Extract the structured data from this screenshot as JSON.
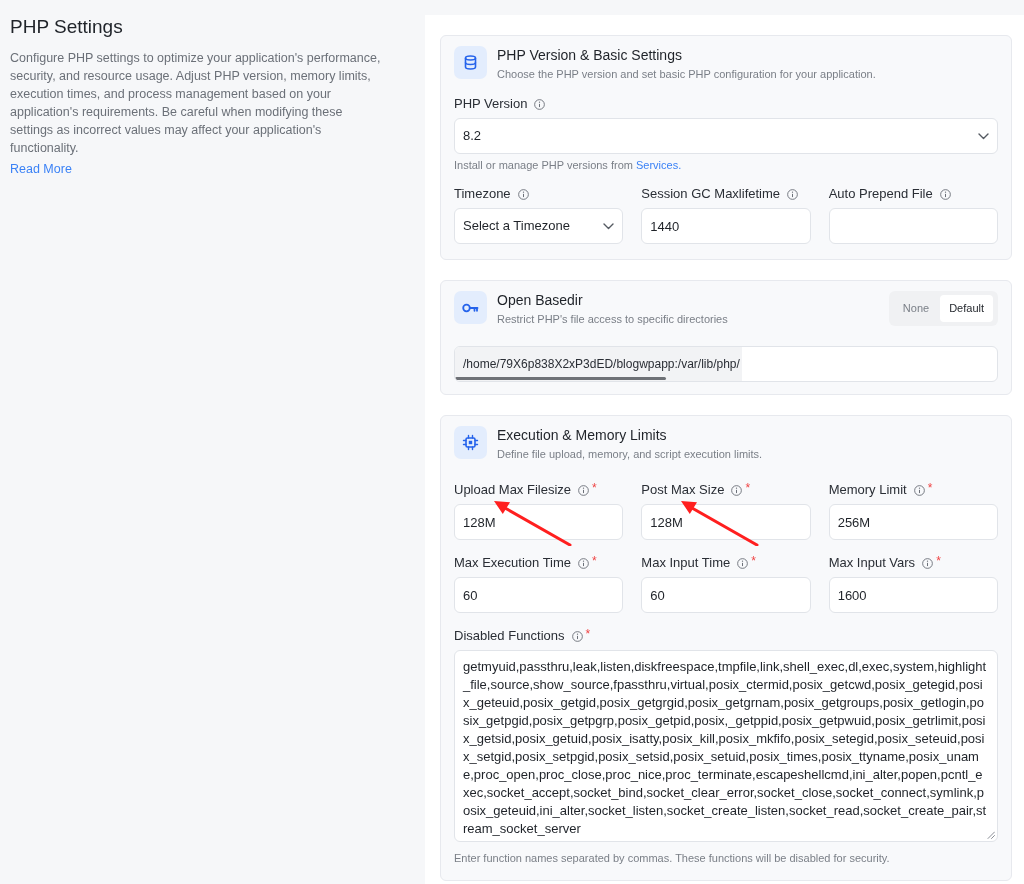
{
  "intro": {
    "title": "PHP Settings",
    "description": "Configure PHP settings to optimize your application's performance, security, and resource usage. Adjust PHP version, memory limits, execution times, and process management based on your application's requirements. Be careful when modifying these settings as incorrect values may affect your application's functionality.",
    "read_more": "Read More"
  },
  "basic_settings": {
    "title": "PHP Version & Basic Settings",
    "subtitle": "Choose the PHP version and set basic PHP configuration for your application.",
    "php_version": {
      "label": "PHP Version",
      "value": "8.2"
    },
    "help": {
      "text": "Install or manage PHP versions from",
      "link": "Services."
    },
    "fields": [
      {
        "label": "Timezone",
        "kind": "select",
        "value": "Select a Timezone"
      },
      {
        "label": "Session GC Maxlifetime",
        "kind": "input",
        "value": "1440"
      },
      {
        "label": "Auto Prepend File",
        "kind": "input"
      }
    ]
  },
  "open_basedir": {
    "title": "Open Basedir",
    "subtitle": "Restrict PHP's file access to specific directories",
    "modes": [
      {
        "label": "None",
        "selected": false
      },
      {
        "label": "Default",
        "selected": true
      }
    ],
    "path": "/home/79X6p838X2xP3dED/blogwpapp:/var/lib/php/"
  },
  "execution_limits": {
    "title": "Execution & Memory Limits",
    "subtitle": "Define file upload, memory, and script execution limits.",
    "fields": [
      {
        "label": "Upload Max Filesize",
        "required_mark": "*",
        "value": "128M",
        "pointed_at": true
      },
      {
        "label": "Post Max Size",
        "required_mark": "*",
        "value": "128M",
        "pointed_at": true
      },
      {
        "label": "Memory Limit",
        "required_mark": "*",
        "value": "256M",
        "pointed_at": false
      },
      {
        "label": "Max Execution Time",
        "required_mark": "*",
        "value": "60",
        "pointed_at": false
      },
      {
        "label": "Max Input Time",
        "required_mark": "*",
        "value": "60",
        "pointed_at": false
      },
      {
        "label": "Max Input Vars",
        "required_mark": "*",
        "value": "1600",
        "pointed_at": false
      }
    ],
    "disabled_functions": {
      "label": "Disabled Functions",
      "required_mark": "*",
      "value": "getmyuid,passthru,leak,listen,diskfreespace,tmpfile,link,shell_exec,dl,exec,system,highlight_file,source,show_source,fpassthru,virtual,posix_ctermid,posix_getcwd,posix_getegid,posix_geteuid,posix_getgid,posix_getgrgid,posix_getgrnam,posix_getgroups,posix_getlogin,posix_getpgid,posix_getpgrp,posix_getpid,posix,_getppid,posix_getpwuid,posix_getrlimit,posix_getsid,posix_getuid,posix_isatty,posix_kill,posix_mkfifo,posix_setegid,posix_seteuid,posix_setgid,posix_setpgid,posix_setsid,posix_setuid,posix_times,posix_ttyname,posix_uname,proc_open,proc_close,proc_nice,proc_terminate,escapeshellcmd,ini_alter,popen,pcntl_exec,socket_accept,socket_bind,socket_clear_error,socket_close,socket_connect,symlink,posix_geteuid,ini_alter,socket_listen,socket_create_listen,socket_read,socket_create_pair,stream_socket_server",
      "help": "Enter function names separated by commas. These functions will be disabled for security."
    }
  }
}
